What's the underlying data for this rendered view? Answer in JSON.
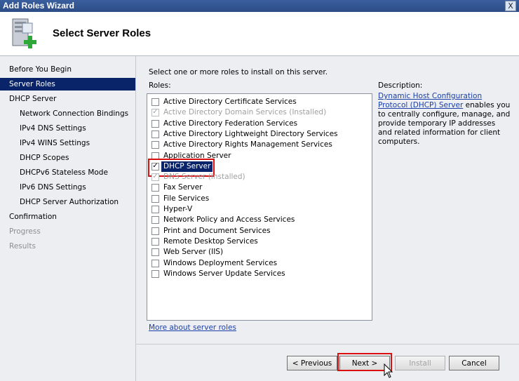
{
  "window": {
    "title": "Add Roles Wizard",
    "close_label": "X"
  },
  "header": {
    "title": "Select Server Roles",
    "icon": "server-add-icon"
  },
  "sidebar": {
    "items": [
      {
        "label": "Before You Begin",
        "state": "normal",
        "indent": false
      },
      {
        "label": "Server Roles",
        "state": "active",
        "indent": false
      },
      {
        "label": "DHCP Server",
        "state": "normal",
        "indent": false
      },
      {
        "label": "Network Connection Bindings",
        "state": "normal",
        "indent": true
      },
      {
        "label": "IPv4 DNS Settings",
        "state": "normal",
        "indent": true
      },
      {
        "label": "IPv4 WINS Settings",
        "state": "normal",
        "indent": true
      },
      {
        "label": "DHCP Scopes",
        "state": "normal",
        "indent": true
      },
      {
        "label": "DHCPv6 Stateless Mode",
        "state": "normal",
        "indent": true
      },
      {
        "label": "IPv6 DNS Settings",
        "state": "normal",
        "indent": true
      },
      {
        "label": "DHCP Server Authorization",
        "state": "normal",
        "indent": true
      },
      {
        "label": "Confirmation",
        "state": "normal",
        "indent": false
      },
      {
        "label": "Progress",
        "state": "disabled",
        "indent": false
      },
      {
        "label": "Results",
        "state": "disabled",
        "indent": false
      }
    ]
  },
  "main": {
    "instruction": "Select one or more roles to install on this server.",
    "roles_label": "Roles:",
    "roles": [
      {
        "label": "Active Directory Certificate Services",
        "checked": false,
        "disabled": false,
        "selected": false
      },
      {
        "label": "Active Directory Domain Services  (Installed)",
        "checked": true,
        "disabled": true,
        "selected": false
      },
      {
        "label": "Active Directory Federation Services",
        "checked": false,
        "disabled": false,
        "selected": false
      },
      {
        "label": "Active Directory Lightweight Directory Services",
        "checked": false,
        "disabled": false,
        "selected": false
      },
      {
        "label": "Active Directory Rights Management Services",
        "checked": false,
        "disabled": false,
        "selected": false
      },
      {
        "label": "Application Server",
        "checked": false,
        "disabled": false,
        "selected": false
      },
      {
        "label": "DHCP Server",
        "checked": true,
        "disabled": false,
        "selected": true
      },
      {
        "label": "DNS Server  (Installed)",
        "checked": true,
        "disabled": true,
        "selected": false
      },
      {
        "label": "Fax Server",
        "checked": false,
        "disabled": false,
        "selected": false
      },
      {
        "label": "File Services",
        "checked": false,
        "disabled": false,
        "selected": false
      },
      {
        "label": "Hyper-V",
        "checked": false,
        "disabled": false,
        "selected": false
      },
      {
        "label": "Network Policy and Access Services",
        "checked": false,
        "disabled": false,
        "selected": false
      },
      {
        "label": "Print and Document Services",
        "checked": false,
        "disabled": false,
        "selected": false
      },
      {
        "label": "Remote Desktop Services",
        "checked": false,
        "disabled": false,
        "selected": false
      },
      {
        "label": "Web Server (IIS)",
        "checked": false,
        "disabled": false,
        "selected": false
      },
      {
        "label": "Windows Deployment Services",
        "checked": false,
        "disabled": false,
        "selected": false
      },
      {
        "label": "Windows Server Update Services",
        "checked": false,
        "disabled": false,
        "selected": false
      }
    ],
    "more_link": "More about server roles"
  },
  "description": {
    "label": "Description:",
    "link_text": "Dynamic Host Configuration Protocol (DHCP) Server",
    "body": " enables you to centrally configure, manage, and provide temporary IP addresses and related information for client computers."
  },
  "buttons": {
    "previous": "< Previous",
    "next": "Next >",
    "install": "Install",
    "cancel": "Cancel"
  },
  "colors": {
    "accent": "#0a246a",
    "highlight_box": "#d81010",
    "link": "#1a3fa8"
  }
}
